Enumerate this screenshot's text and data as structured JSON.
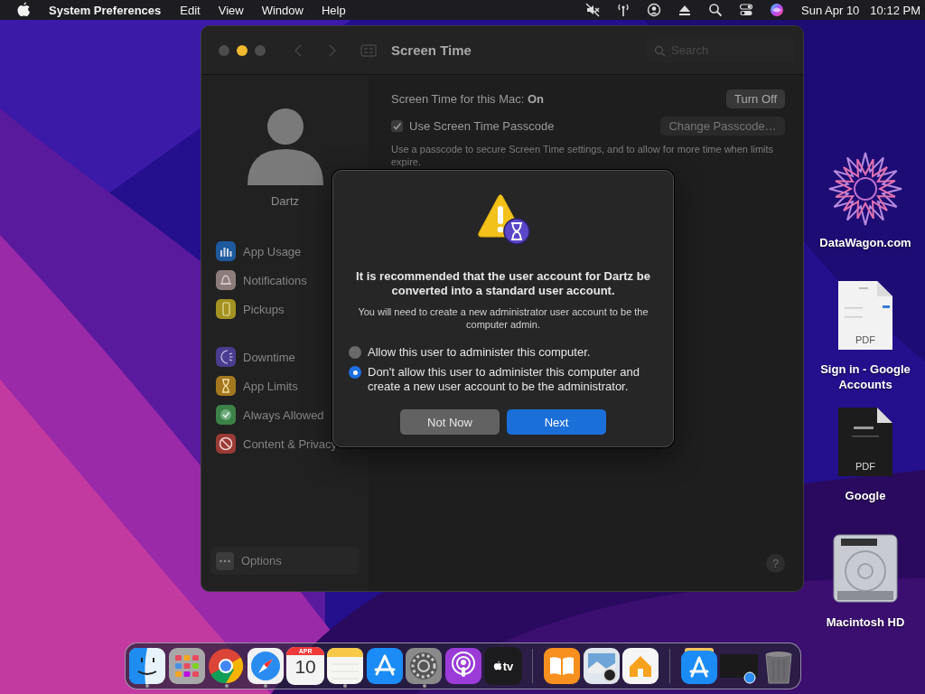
{
  "menu_bar": {
    "app": "System Preferences",
    "menus": [
      "Edit",
      "View",
      "Window",
      "Help"
    ],
    "status_icons": [
      {
        "kind": "mute"
      },
      {
        "kind": "antenna"
      },
      {
        "kind": "user"
      },
      {
        "kind": "eject"
      },
      {
        "kind": "search"
      },
      {
        "kind": "toggles"
      },
      {
        "kind": "siri"
      }
    ],
    "date": "Sun Apr 10",
    "time": "10:12 PM"
  },
  "window": {
    "title": "Screen Time",
    "search": {
      "placeholder": "Search"
    },
    "user": {
      "name": "Dartz"
    },
    "sidebar": {
      "groups": [
        {
          "items": [
            {
              "label": "App Usage",
              "kind": "usage",
              "color": "#1d5a9e"
            },
            {
              "label": "Notifications",
              "kind": "bell",
              "color": "#8c7c7c"
            },
            {
              "label": "Pickups",
              "kind": "phone",
              "color": "#a39222"
            }
          ]
        },
        {
          "items": [
            {
              "label": "Downtime",
              "kind": "moon",
              "color": "#4a3d8f"
            },
            {
              "label": "App Limits",
              "kind": "hourglass",
              "color": "#a3781e"
            },
            {
              "label": "Always Allowed",
              "kind": "check",
              "color": "#3b8148"
            },
            {
              "label": "Content & Privacy",
              "kind": "block",
              "color": "#9a3a35"
            }
          ]
        }
      ]
    },
    "options": {
      "label": "Options"
    },
    "status_line": "Screen Time for this Mac: **On**",
    "turn_off": "Turn Off",
    "passcode": {
      "label": "Use Screen Time Passcode",
      "checked": true
    },
    "change_passcode": {
      "label": "Change Passcode…",
      "disabled": true
    },
    "description": "Use a passcode to secure Screen Time settings, and to allow for more time when limits expire.",
    "help": "?"
  },
  "dialog": {
    "title": "It is recommended that the user account for Dartz be converted into a standard user account.",
    "message": "You will need to create a new administrator user account to be the computer admin.",
    "options": [
      {
        "label": "Allow this user to administer this computer.",
        "selected": false
      },
      {
        "label": "Don't allow this user to administer this computer and create a new user account to be the administrator.",
        "selected": true
      }
    ],
    "buttons": [
      {
        "label": "Not Now",
        "default": false
      },
      {
        "label": "Next",
        "default": true
      }
    ]
  },
  "desktop_icons": [
    {
      "label": "DataWagon.com",
      "kind": "star"
    },
    {
      "label": "Sign in - Google Accounts",
      "kind": "pdf",
      "badge": "PDF"
    },
    {
      "label": "Google",
      "kind": "pdf-dark",
      "badge": "PDF"
    },
    {
      "label": "Macintosh HD",
      "kind": "drive"
    }
  ],
  "dock": {
    "sections": [
      {
        "items": [
          {
            "kind": "finder",
            "running": true
          },
          {
            "kind": "launchpad",
            "running": false
          },
          {
            "kind": "chrome",
            "running": true
          },
          {
            "kind": "safari",
            "running": true
          },
          {
            "kind": "calendar",
            "month": "APR",
            "day": "10",
            "running": false
          },
          {
            "kind": "notes",
            "running": true
          },
          {
            "kind": "appstore",
            "running": false
          },
          {
            "kind": "settings",
            "running": true
          },
          {
            "kind": "podcasts",
            "running": false
          },
          {
            "kind": "tv",
            "text": "tv",
            "running": false
          }
        ]
      },
      {
        "items": [
          {
            "kind": "books",
            "running": false
          },
          {
            "kind": "preview",
            "running": false
          },
          {
            "kind": "home",
            "running": false
          }
        ]
      },
      {
        "items": [
          {
            "kind": "stack",
            "running": false
          },
          {
            "kind": "minimized",
            "running": false
          },
          {
            "kind": "trash",
            "running": false
          }
        ]
      }
    ]
  }
}
